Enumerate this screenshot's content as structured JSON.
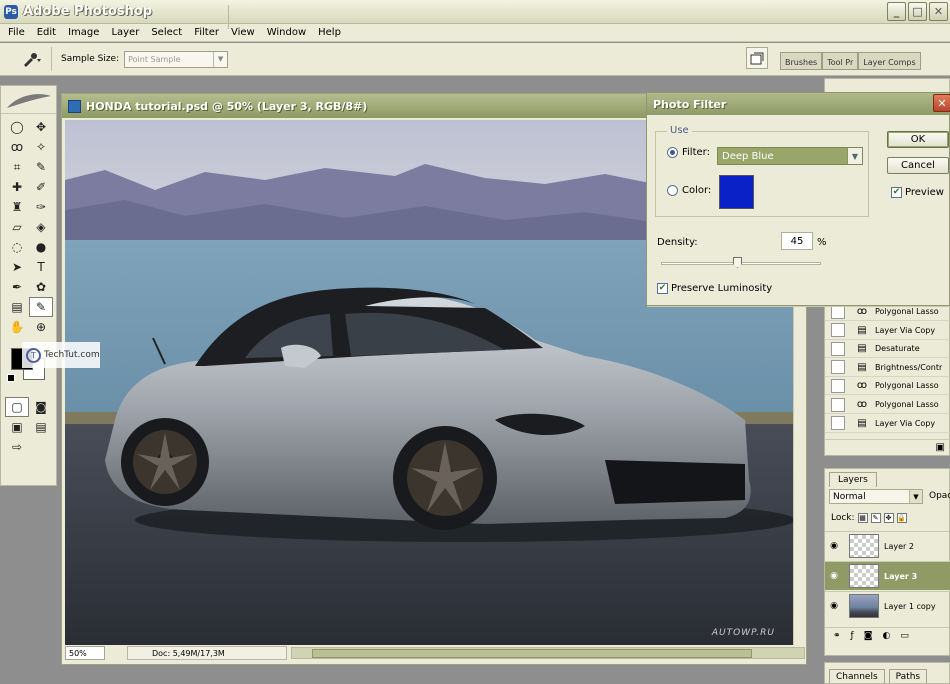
{
  "app": {
    "title": "Adobe Photoshop"
  },
  "window_buttons": [
    "_",
    "□",
    "✕"
  ],
  "menu": [
    "File",
    "Edit",
    "Image",
    "Layer",
    "Select",
    "Filter",
    "View",
    "Window",
    "Help"
  ],
  "options": {
    "sample_size_label": "Sample Size:",
    "sample_size_value": "Point Sample"
  },
  "palette_well_tabs": [
    "Brushes",
    "Tool Pr",
    "Layer Comps"
  ],
  "document": {
    "title": "HONDA tutorial.psd @ 50% (Layer 3, RGB/8#)",
    "zoom": "50%",
    "doc_size": "Doc: 5,49M/17,3M",
    "watermark": "AUTOWP.RU"
  },
  "watermark_site": "TechTut.com",
  "photo_filter": {
    "title": "Photo Filter",
    "use_label": "Use",
    "filter_label": "Filter:",
    "filter_value": "Deep Blue",
    "color_label": "Color:",
    "color_swatch": "#0a21c7",
    "ok": "OK",
    "cancel": "Cancel",
    "preview": "Preview",
    "density_label": "Density:",
    "density_value": "45",
    "density_unit": "%",
    "density_fraction": 0.45,
    "preserve": "Preserve Luminosity"
  },
  "history": {
    "items": [
      "Polygonal Lasso",
      "Layer Via Copy",
      "Desaturate",
      "Brightness/Contr",
      "Polygonal Lasso",
      "Polygonal Lasso",
      "Layer Via Copy"
    ]
  },
  "layers": {
    "tab": "Layers",
    "blend": "Normal",
    "opacity_label": "Opac",
    "lock_label": "Lock:",
    "rows": [
      {
        "name": "Layer 2",
        "selected": false,
        "photo": false
      },
      {
        "name": "Layer 3",
        "selected": true,
        "photo": false
      },
      {
        "name": "Layer 1 copy",
        "selected": false,
        "photo": true
      }
    ]
  },
  "bottom_tabs": [
    "Channels",
    "Paths"
  ]
}
